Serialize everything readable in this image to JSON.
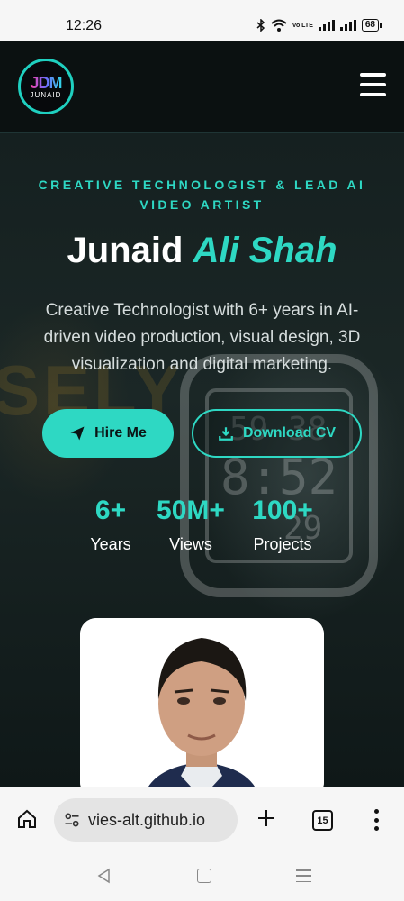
{
  "status_bar": {
    "time": "12:26",
    "network": "Vo LTE",
    "battery": "68"
  },
  "header": {
    "logo_mark": "JDM",
    "logo_name": "JUNAID"
  },
  "hero": {
    "eyebrow": "CREATIVE TECHNOLOGIST & LEAD AI VIDEO ARTIST",
    "title_first": "Junaid",
    "title_highlight": "Ali Shah",
    "description": "Creative Technologist with 6+ years in AI-driven video production, visual design, 3D visualization and digital marketing.",
    "hire_label": "Hire Me",
    "download_label": "Download CV",
    "stats": [
      {
        "value": "6+",
        "label": "Years"
      },
      {
        "value": "50M+",
        "label": "Views"
      },
      {
        "value": "100+",
        "label": "Projects"
      }
    ]
  },
  "colors": {
    "accent": "#2ed8c3",
    "background": "#0c1414",
    "whatsapp": "#25c25c",
    "email": "#e8443a"
  },
  "icons": {
    "hire": "paper-plane-icon",
    "download": "download-icon",
    "whatsapp": "whatsapp-icon",
    "email": "envelope-icon",
    "chat": "chat-bubble-icon",
    "menu": "hamburger-menu-icon"
  },
  "browser": {
    "url": "vies-alt.github.io",
    "tab_count": "15"
  }
}
